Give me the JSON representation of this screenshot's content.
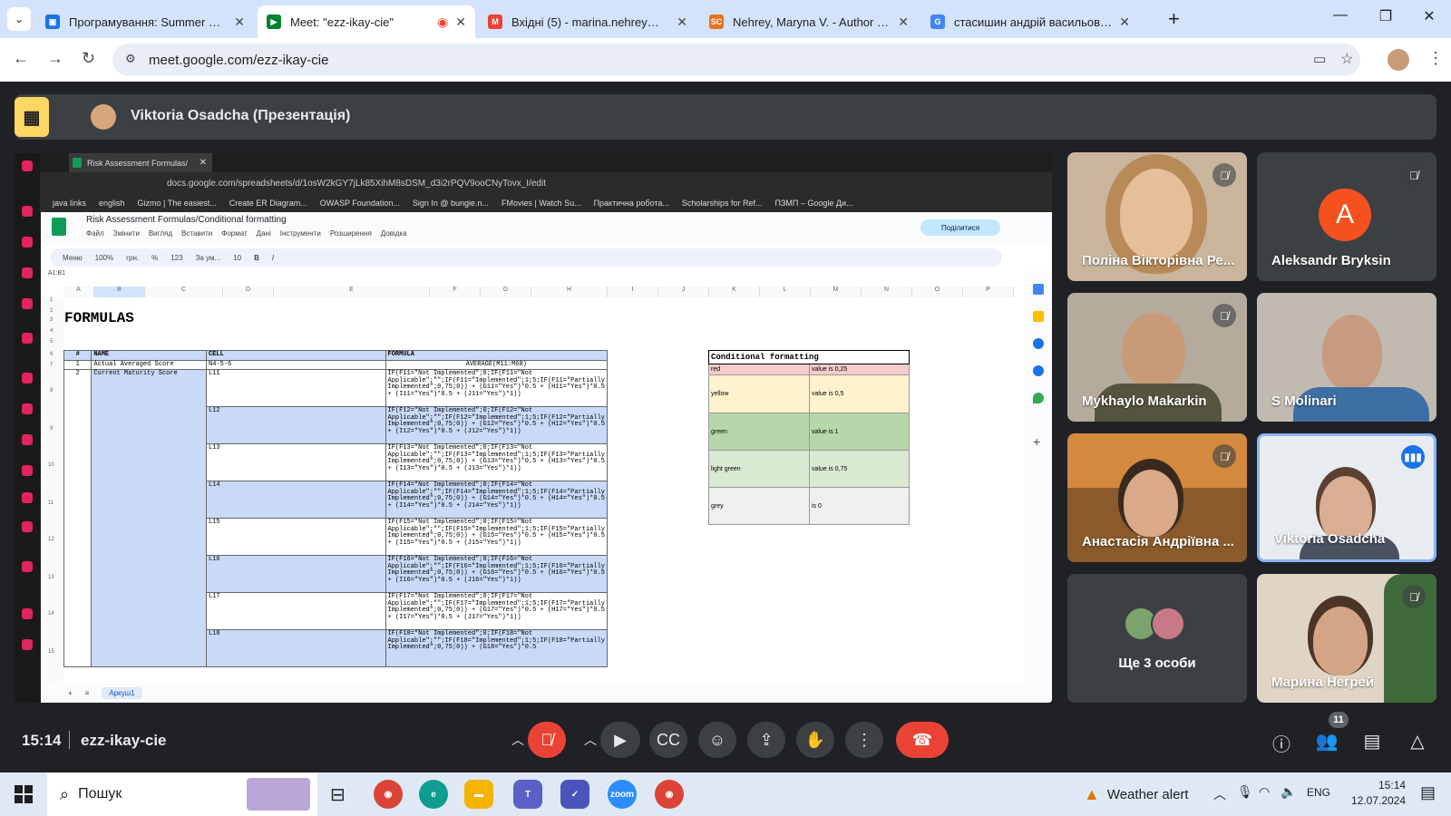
{
  "browser": {
    "tabs": [
      {
        "title": "Програмування: Summer Scho",
        "favicon_color": "#1a73e8"
      },
      {
        "title": "Meet: \"ezz-ikay-cie\"",
        "favicon_color": "#00832d"
      },
      {
        "title": "Вхідні (5) - marina.nehrey@nub",
        "favicon_color": "#ea4335"
      },
      {
        "title": "Nehrey, Maryna V. - Author det",
        "favicon_color": "#e9711c"
      },
      {
        "title": "стасишин андрій васильович",
        "favicon_color": "#4285f4"
      }
    ],
    "new_tab": "+",
    "url": "meet.google.com/ezz-ikay-cie"
  },
  "presentation": {
    "presenter": "Viktoria Osadcha (Презентація)"
  },
  "shared_screen": {
    "tab_title": "Risk Assessment Formulas/",
    "url": "docs.google.com/spreadsheets/d/1osW2kGY7jLk85XihM8sDSM_d3i2rPQV9ooCNyTovx_I/edit",
    "bookmarks": [
      "java links",
      "english",
      "Gizmo | The easiest...",
      "Create ER Diagram...",
      "OWASP Foundation...",
      "Sign In @ bungie.n...",
      "FMovies | Watch Su...",
      "Практична робота...",
      "Scholarships for Ref...",
      "ПЗМП – Google Ди..."
    ],
    "sheet": {
      "doc_title": "Risk Assessment Formulas/Conditional formatting",
      "menu": [
        "Файл",
        "Змінити",
        "Вигляд",
        "Вставити",
        "Формат",
        "Дані",
        "Інструменти",
        "Розширення",
        "Довідка"
      ],
      "toolbar": [
        "Меню",
        "100%",
        "грн.",
        "%",
        "123",
        "За ум...",
        "10",
        "B",
        "I"
      ],
      "share_label": "Поділитися",
      "cell_ref": "A1:B1",
      "columns": [
        "A",
        "B",
        "C",
        "D",
        "E",
        "F",
        "G",
        "H",
        "I",
        "J",
        "K",
        "L",
        "M",
        "N",
        "O",
        "P"
      ],
      "rows": [
        "1",
        "2",
        "3",
        "4",
        "5",
        "6",
        "7",
        "8",
        "9",
        "10",
        "11",
        "12",
        "13",
        "14",
        "15"
      ],
      "heading": "FORMULAS",
      "table_headers": [
        "#",
        "NAME",
        "CELL",
        "FORMULA"
      ],
      "row1": {
        "num": "1",
        "name": "Actual Averaged Score",
        "cell": "N4-5-6",
        "formula": "AVERAGE(M11:M68)"
      },
      "row2": {
        "num": "2",
        "name": "Current Maturity Score"
      },
      "formula_rows": [
        {
          "cell": "L11",
          "formula": "IF(F11=\"Not Implemented\";0;IF(F11=\"Not Applicable\";\"\";IF(F11=\"Implemented\";1;5;IF(F11=\"Partially Implemented\";0,75;0)) + (G11=\"Yes\")*0.5 + (H11=\"Yes\")*0.5 + (I11=\"Yes\")*0.5 + (J11=\"Yes\")*1))"
        },
        {
          "cell": "L12",
          "formula": "IF(F12=\"Not Implemented\";0;IF(F12=\"Not Applicable\";\"\";IF(F12=\"Implemented\";1;5;IF(F12=\"Partially Implemented\";0,75;0)) + (G12=\"Yes\")*0.5 + (H12=\"Yes\")*0.5 + (I12=\"Yes\")*0.5 + (J12=\"Yes\")*1))"
        },
        {
          "cell": "L13",
          "formula": "IF(F13=\"Not Implemented\";0;IF(F13=\"Not Applicable\";\"\";IF(F13=\"Implemented\";1;5;IF(F13=\"Partially Implemented\";0,75;0)) + (G13=\"Yes\")*0.5 + (H13=\"Yes\")*0.5 + (I13=\"Yes\")*0.5 + (J13=\"Yes\")*1))"
        },
        {
          "cell": "L14",
          "formula": "IF(F14=\"Not Implemented\";0;IF(F14=\"Not Applicable\";\"\";IF(F14=\"Implemented\";1;5;IF(F14=\"Partially Implemented\";0,75;0)) + (G14=\"Yes\")*0.5 + (H14=\"Yes\")*0.5 + (I14=\"Yes\")*0.5 + (J14=\"Yes\")*1))"
        },
        {
          "cell": "L15",
          "formula": "IF(F15=\"Not Implemented\";0;IF(F15=\"Not Applicable\";\"\";IF(F15=\"Implemented\";1;5;IF(F15=\"Partially Implemented\";0,75;0)) + (G15=\"Yes\")*0.5 + (H15=\"Yes\")*0.5 + (I15=\"Yes\")*0.5 + (J15=\"Yes\")*1))"
        },
        {
          "cell": "L16",
          "formula": "IF(F16=\"Not Implemented\";0;IF(F16=\"Not Applicable\";\"\";IF(F16=\"Implemented\";1;5;IF(F16=\"Partially Implemented\";0,75;0)) + (G16=\"Yes\")*0.5 + (H16=\"Yes\")*0.5 + (I16=\"Yes\")*0.5 + (J16=\"Yes\")*1))"
        },
        {
          "cell": "L17",
          "formula": "IF(F17=\"Not Implemented\";0;IF(F17=\"Not Applicable\";\"\";IF(F17=\"Implemented\";1;5;IF(F17=\"Partially Implemented\";0,75;0)) + (G17=\"Yes\")*0.5 + (H17=\"Yes\")*0.5 + (I17=\"Yes\")*0.5 + (J17=\"Yes\")*1))"
        },
        {
          "cell": "L18",
          "formula": "IF(F18=\"Not Implemented\";0;IF(F18=\"Not Applicable\";\"\";IF(F18=\"Implemented\";1;5;IF(F18=\"Partially Implemented\";0,75;0)) + (G18=\"Yes\")*0.5"
        }
      ],
      "cf_title": "Conditional formatting",
      "cf_rows": [
        {
          "label": "red",
          "value": "value is 0,25",
          "color": "#f4cccc"
        },
        {
          "label": "yellow",
          "value": "value is 0,5",
          "color": "#fff2cc"
        },
        {
          "label": "green",
          "value": "value is 1",
          "color": "#b6d7a8"
        },
        {
          "label": "light green",
          "value": "value is 0,75",
          "color": "#d9ead3"
        },
        {
          "label": "grey",
          "value": "is 0",
          "color": "#efefef"
        }
      ],
      "sheet_tab": "Аркуш1"
    }
  },
  "participants": [
    {
      "name": "Поліна Вікторівна Ре...",
      "muted": true,
      "bg": "#c9b59b"
    },
    {
      "name": "Aleksandr Bryksin",
      "muted": true,
      "letter": "A",
      "bg": "#3c4043"
    },
    {
      "name": "Mykhaylo Makarkin",
      "muted": true,
      "bg": "#b4ab9c"
    },
    {
      "name": "S Molinari",
      "muted": false,
      "bg": "#c0bab0"
    },
    {
      "name": "Анастасія Андріївна ...",
      "muted": true,
      "bg": "#d38a3e"
    },
    {
      "name": "Viktoria Osadcha",
      "muted": false,
      "speaking": true,
      "bg": "#e8ebef"
    },
    {
      "name": "Ще 3 особи",
      "bg": "#3c4043"
    },
    {
      "name": "Марина Негрей",
      "muted": true,
      "bg": "#e0d5c4"
    }
  ],
  "meeting": {
    "time": "15:14",
    "code": "ezz-ikay-cie",
    "participant_count": "11"
  },
  "taskbar": {
    "search": "Пошук",
    "weather": "Weather alert",
    "lang": "ENG",
    "time": "15:14",
    "date": "12.07.2024"
  }
}
